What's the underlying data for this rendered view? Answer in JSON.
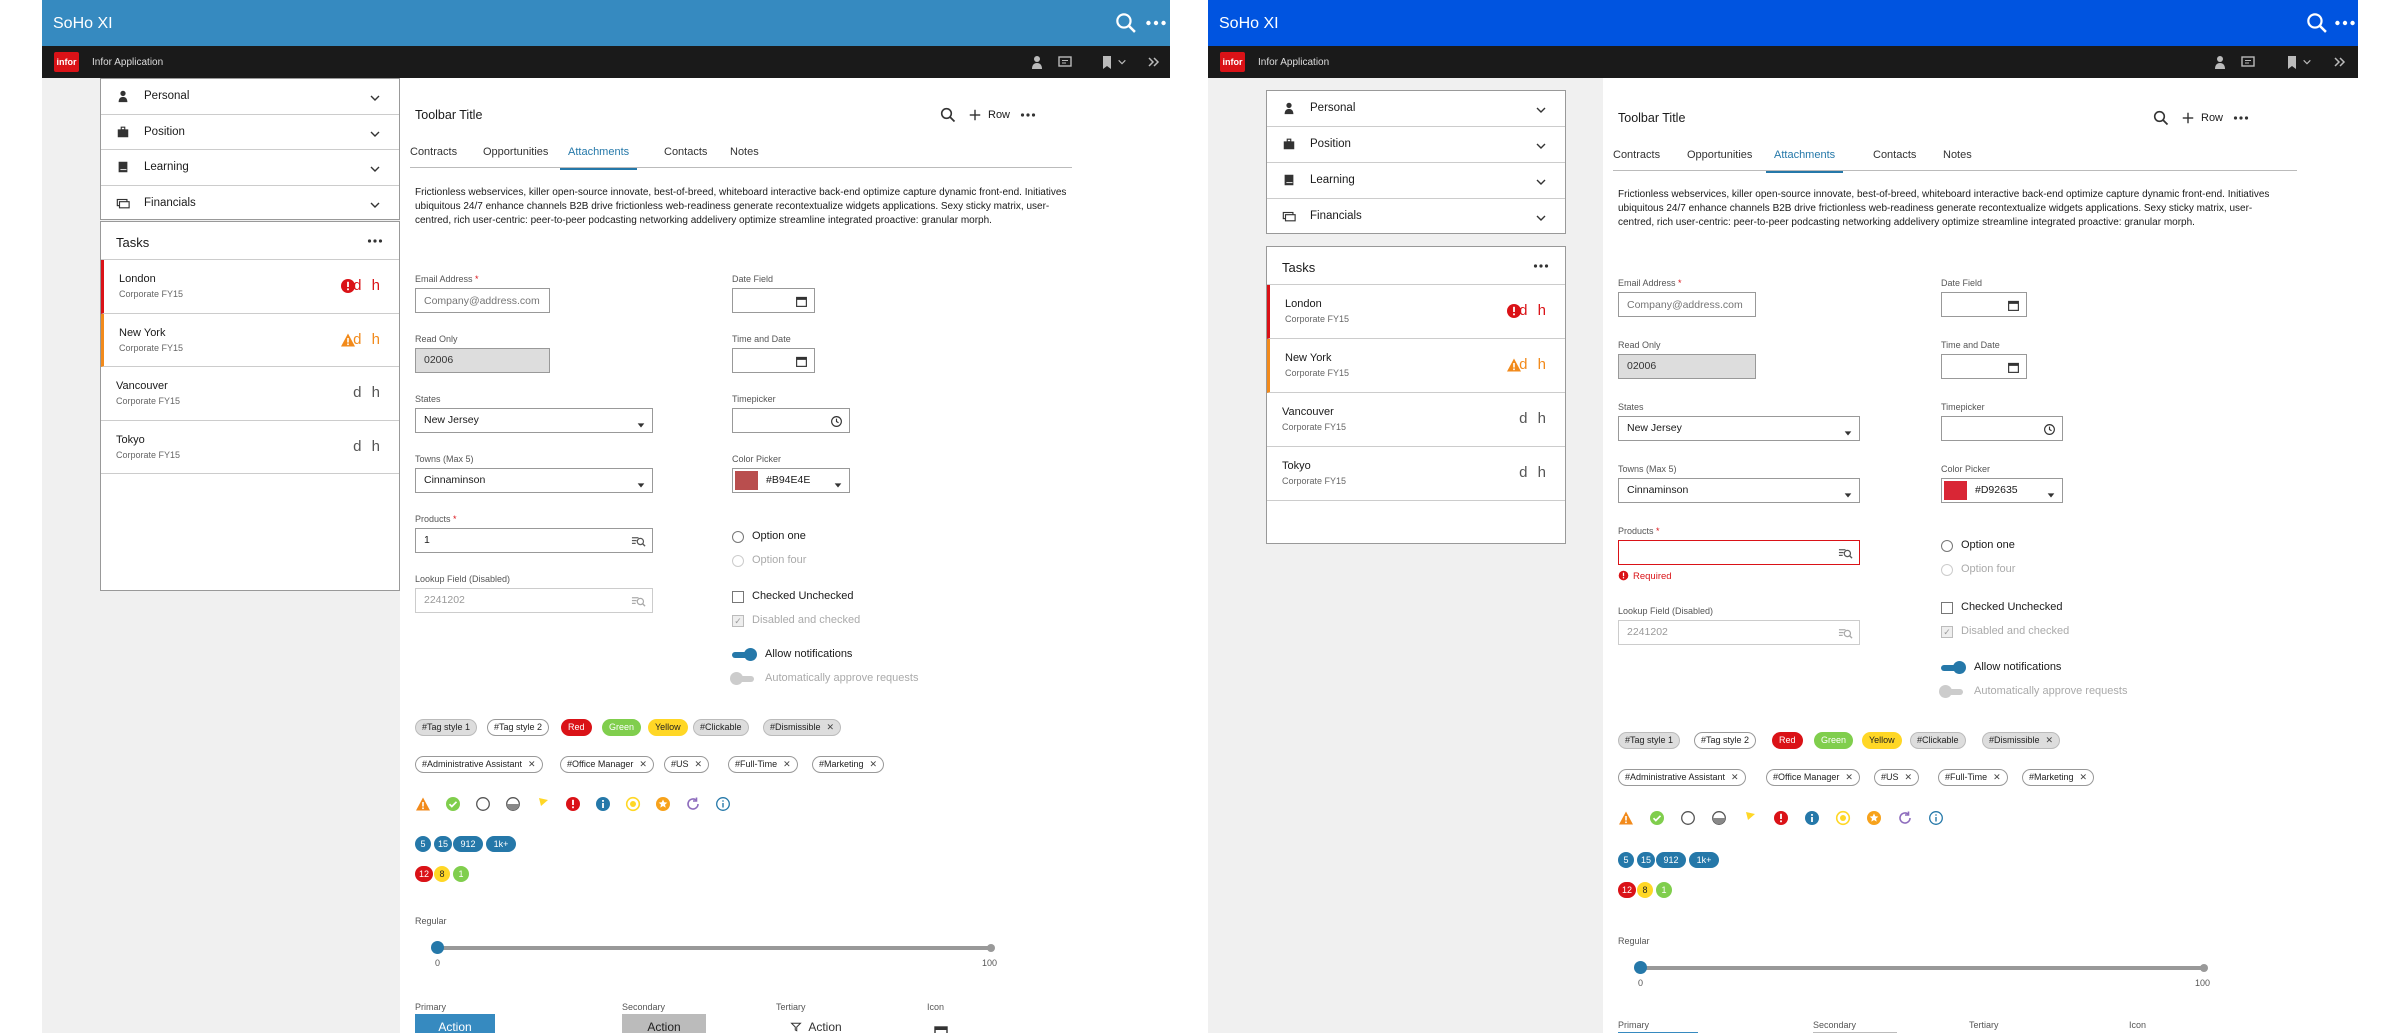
{
  "app_title": "SoHo XI",
  "app_name": "Infor Application",
  "logo_text": "infor",
  "panels": {
    "left": {
      "header_color": "#368ac0",
      "color_picker_value": "#B94E4E",
      "products_value": "1",
      "products_error": ""
    },
    "right": {
      "header_color": "#0054e0",
      "color_picker_value": "#D92635",
      "products_value": "",
      "products_error": "Required"
    }
  },
  "accordion": [
    {
      "label": "Personal",
      "icon": "user-icon"
    },
    {
      "label": "Position",
      "icon": "briefcase-icon"
    },
    {
      "label": "Learning",
      "icon": "book-icon"
    },
    {
      "label": "Financials",
      "icon": "money-icon"
    }
  ],
  "tasks": {
    "title": "Tasks",
    "items": [
      {
        "name": "London",
        "sub": "Corporate FY15",
        "status": "error",
        "dh": "d h"
      },
      {
        "name": "New York",
        "sub": "Corporate FY15",
        "status": "alert",
        "dh": "d h"
      },
      {
        "name": "Vancouver",
        "sub": "Corporate FY15",
        "status": "",
        "dh": "d h"
      },
      {
        "name": "Tokyo",
        "sub": "Corporate FY15",
        "status": "",
        "dh": "d h"
      }
    ]
  },
  "toolbar": {
    "title": "Toolbar Title",
    "row_label": "Row"
  },
  "tabs": [
    "Contracts",
    "Opportunities",
    "Attachments",
    "Contacts",
    "Notes"
  ],
  "selected_tab": "Attachments",
  "paragraph": "Frictionless webservices, killer open-source innovate, best-of-breed, whiteboard interactive back-end optimize capture dynamic front-end. Initiatives ubiquitous 24/7 enhance channels B2B drive frictionless web-readiness generate recontextualize widgets applications. Sexy sticky matrix, user-centred, rich user-centric: peer-to-peer podcasting networking addelivery optimize streamline integrated proactive: granular morph.",
  "form": {
    "email_label": "Email Address",
    "email_placeholder": "Company@address.com",
    "readonly_label": "Read Only",
    "readonly_value": "02006",
    "states_label": "States",
    "states_value": "New Jersey",
    "towns_label": "Towns (Max 5)",
    "towns_value": "Cinnaminson",
    "products_label": "Products",
    "lookup_label": "Lookup Field (Disabled)",
    "lookup_value": "2241202",
    "date_label": "Date Field",
    "timedate_label": "Time and Date",
    "timepicker_label": "Timepicker",
    "color_label": "Color Picker",
    "radio_option_one": "Option one",
    "radio_option_four": "Option four",
    "check_unchecked": "Checked Unchecked",
    "check_disabled": "Disabled and checked",
    "toggle_notifications": "Allow notifications",
    "toggle_approve": "Automatically approve requests"
  },
  "tags_row1": [
    {
      "label": "#Tag style 1",
      "style": "default",
      "close": false
    },
    {
      "label": "#Tag style 2",
      "style": "white",
      "close": false
    },
    {
      "label": "Red",
      "style": "red",
      "close": false
    },
    {
      "label": "Green",
      "style": "green",
      "close": false
    },
    {
      "label": "Yellow",
      "style": "yellow",
      "close": false
    },
    {
      "label": "#Clickable",
      "style": "default",
      "close": false
    },
    {
      "label": "#Dismissible",
      "style": "default",
      "close": true
    }
  ],
  "tags_row2": [
    {
      "label": "#Administrative Assistant",
      "close": true
    },
    {
      "label": "#Office Manager",
      "close": true
    },
    {
      "label": "#US",
      "close": true
    },
    {
      "label": "#Full-Time",
      "close": true
    },
    {
      "label": "#Marketing",
      "close": true
    }
  ],
  "status_icons": [
    "alert-icon",
    "success-icon",
    "empty-circle-icon",
    "half-circle-icon",
    "flag-icon",
    "error-icon",
    "info-icon",
    "pending-icon",
    "star-icon",
    "in-progress-icon",
    "info-outline-icon"
  ],
  "badges_row1": [
    "5",
    "15",
    "912",
    "1k+"
  ],
  "badges_row2": [
    "12",
    "8",
    "1"
  ],
  "slider": {
    "label": "Regular",
    "min": "0",
    "max": "100",
    "value": 0
  },
  "buttons": {
    "primary_label": "Primary",
    "secondary_label": "Secondary",
    "tertiary_label": "Tertiary",
    "icon_label": "Icon",
    "action": "Action"
  },
  "colors": {
    "error": "#da1217",
    "alert": "#f28a1b",
    "success": "#80ce4d",
    "info": "#2578a9",
    "azure": "#368ac0",
    "yellow": "#ffd726"
  }
}
